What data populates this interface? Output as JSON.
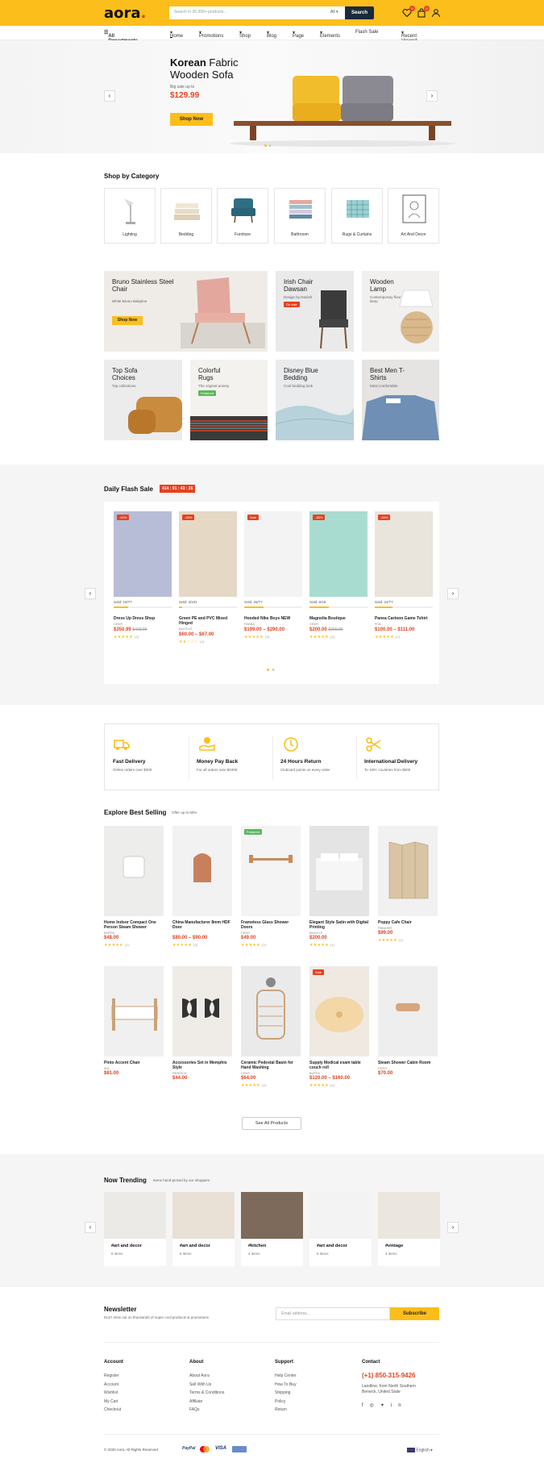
{
  "header": {
    "logo_main": "aora",
    "logo_dot": ".",
    "search_placeholder": "Search in 20.000+ products...",
    "search_category": "All",
    "search_button": "Search",
    "wishlist_count": "0",
    "cart_count": "0"
  },
  "nav": {
    "departments": "All Departments",
    "items": [
      "Home",
      "Promotions",
      "Shop",
      "Blog",
      "Page",
      "Elements",
      "Flash Sale"
    ],
    "recent": "Recent Viewed"
  },
  "hero": {
    "title_bold": "Korean",
    "title_rest": " Fabric",
    "title_line2": "Wooden Sofa",
    "subtitle": "Big sale up to",
    "price": "$129.99",
    "button": "Shop Now"
  },
  "categories": {
    "title": "Shop by Category",
    "items": [
      "Lighting",
      "Bedding",
      "Furniture",
      "Bathroom",
      "Rugs & Curtains",
      "Art And Decor"
    ]
  },
  "promos": [
    {
      "title": "Bruno Stainless Steel Chair",
      "sub": "White Bruno Babyline",
      "button": "Shop Now"
    },
    {
      "title": "Irish Chair Dawsan",
      "sub": "Design by Danish",
      "badge": "On sale"
    },
    {
      "title": "Wooden Lamp",
      "sub": "Contemporary floor lamp"
    },
    {
      "title": "Top Sofa Choices",
      "sub": "Top collections"
    },
    {
      "title": "Colorful Rugs",
      "sub": "The original antony",
      "badge": "Featured"
    },
    {
      "title": "Disney Blue Bedding",
      "sub": "Cool bedding look"
    },
    {
      "title": "Best Men T-Shirts",
      "sub": "Most comfortable"
    }
  ],
  "flash": {
    "title": "Daily Flash Sale",
    "timer": "414 : 01 : 43 : 26",
    "products": [
      {
        "badge": "-20%",
        "sold": "Sold: 19/77",
        "name": "Dress Up Dress Shop",
        "brand": "CEMY",
        "price": "$350.99",
        "old": "$429.00",
        "reviews": "(3)"
      },
      {
        "badge": "-34%",
        "sold": "Sold: 4/101",
        "name": "Green PE and PVC Mixed Hinged",
        "brand": "BUCKYZ",
        "price": "$60.00 – $67.00",
        "old": "",
        "reviews": "(3)"
      },
      {
        "badge": "Sale",
        "sold": "Sold: 26/77",
        "name": "Hooded Nike Boys NEW",
        "brand": "FAKBA",
        "price": "$199.00 – $290.00",
        "old": "",
        "reviews": "(3)"
      },
      {
        "badge": "-36%",
        "sold": "Sold: 6/18",
        "name": "Magnolia Boutique",
        "brand": "CEMY",
        "price": "$200.00",
        "old": "$300.00",
        "reviews": "(2)"
      },
      {
        "badge": "-16%",
        "sold": "Sold: 24/77",
        "name": "Panea Cartoon Game Tshirt",
        "brand": "RTA",
        "price": "$100.00 – $111.00",
        "old": "",
        "reviews": "(2)"
      }
    ]
  },
  "features": [
    {
      "title": "Fast Delivery",
      "sub": "Online orders over $200"
    },
    {
      "title": "Money Pay Back",
      "sub": "For all orders over $1000"
    },
    {
      "title": "24 Hours Return",
      "sub": "Clubcard points on every order"
    },
    {
      "title": "International Delivery",
      "sub": "To 100+ countries from $500"
    }
  ],
  "best": {
    "title": "Explore Best Selling",
    "sub": "Offer up to 50%",
    "products": [
      {
        "name": "Home Indoor Compact One Person Steam Shower",
        "brand": "BUFFA",
        "price": "$48.00",
        "reviews": "(1)"
      },
      {
        "name": "China Manufacturer 8mm HDF Door",
        "brand": "",
        "price": "$80.00 – $90.00",
        "reviews": "(3)"
      },
      {
        "name": "Frameless Glass Shower Doors",
        "brand": "CEMY",
        "price": "$49.00",
        "reviews": "(2)",
        "badge": "Featured"
      },
      {
        "name": "Elegant Style Satin with Digital Printing",
        "brand": "BUCKYZ",
        "price": "$200.00",
        "reviews": "(1)"
      },
      {
        "name": "Poppy Cafe Chair",
        "brand": "PANASIR",
        "price": "$99.00",
        "reviews": "(2)"
      },
      {
        "name": "Pinto Accent Chair",
        "brand": "IKA",
        "price": "$81.00",
        "reviews": ""
      },
      {
        "name": "Accessories Set in Memphis Style",
        "brand": "PENDICK",
        "price": "$44.00",
        "reviews": ""
      },
      {
        "name": "Ceramic Pedestal Basin for Hand Washing",
        "brand": "CEMY",
        "price": "$64.00",
        "reviews": "(2)"
      },
      {
        "name": "Supply Medical exam table couch roll",
        "brand": "BUFFA",
        "price": "$120.00 – $160.00",
        "reviews": "(4)",
        "badge": "Sale"
      },
      {
        "name": "Steam Shower Cabin Room",
        "brand": "CEMY",
        "price": "$70.00",
        "reviews": ""
      }
    ],
    "see_all": "See All Products"
  },
  "trending": {
    "title": "Now Trending",
    "sub": "Items hand-picked by our shoppers",
    "items": [
      {
        "tag": "#art and decor",
        "count": "6 items"
      },
      {
        "tag": "#art and decor",
        "count": "6 items"
      },
      {
        "tag": "#kitchen",
        "count": "4 items"
      },
      {
        "tag": "#art and decor",
        "count": "6 items"
      },
      {
        "tag": "#vintage",
        "count": "4 items"
      }
    ]
  },
  "newsletter": {
    "title": "Newsletter",
    "sub": "Don't miss out on thousands of super cool products & promotions",
    "placeholder": "Email address...",
    "button": "Subscribe"
  },
  "footer": {
    "account": {
      "title": "Account",
      "links": [
        "Register",
        "Account",
        "Wishlist",
        "My Cart",
        "Checkout"
      ]
    },
    "about": {
      "title": "About",
      "links": [
        "About Aora",
        "Sell With Us",
        "Terms & Conditions",
        "Affiliate",
        "FAQs"
      ]
    },
    "support": {
      "title": "Support",
      "links": [
        "Help Center",
        "How To Buy",
        "Shipping",
        "Policy",
        "Return"
      ]
    },
    "contact": {
      "title": "Contact",
      "phone": "(+1) 850-315-9426",
      "address": "Landline, from North Southern Berwick, United State"
    },
    "copyright": "© 2020 Aora. All Rights Reserved",
    "payments": [
      "PayPal",
      "VISA"
    ],
    "language": "English"
  },
  "colors": {
    "accent": "#fcbe1a",
    "sale": "#e5421f",
    "dark": "#1a2a3a"
  }
}
